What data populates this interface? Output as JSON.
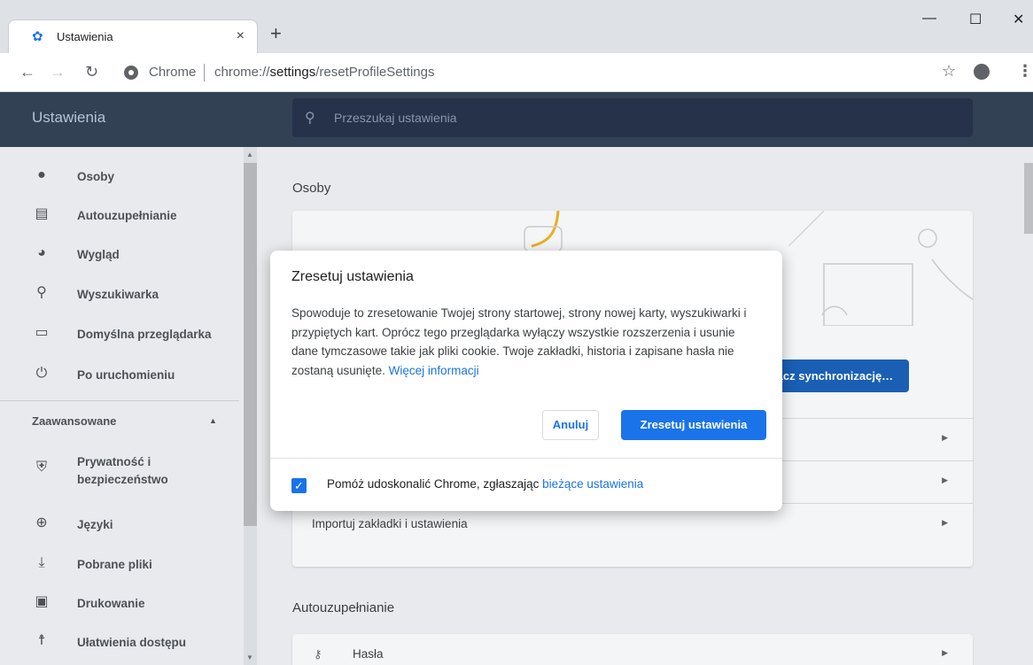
{
  "browser": {
    "tab_title": "Ustawienia",
    "tab_close": "×",
    "new_tab": "+",
    "win_minimize": "—",
    "win_maximize": "☐",
    "win_close": "✕",
    "url_chip": "Chrome",
    "url_prefix": "chrome://",
    "url_bold": "settings",
    "url_rest": "/resetProfileSettings"
  },
  "header": {
    "title": "Ustawienia",
    "search_placeholder": "Przeszukaj ustawienia"
  },
  "sidebar": {
    "items": [
      {
        "label": "Osoby",
        "icon": "person-icon"
      },
      {
        "label": "Autouzupełnianie",
        "icon": "clipboard-icon"
      },
      {
        "label": "Wygląd",
        "icon": "palette-icon"
      },
      {
        "label": "Wyszukiwarka",
        "icon": "search-icon"
      },
      {
        "label": "Domyślna przeglądarka",
        "icon": "browser-icon"
      },
      {
        "label": "Po uruchomieniu",
        "icon": "power-icon"
      }
    ],
    "advanced_label": "Zaawansowane",
    "advanced_items": [
      {
        "label": "Prywatność i bezpieczeństwo",
        "icon": "shield-icon"
      },
      {
        "label": "Języki",
        "icon": "globe-icon"
      },
      {
        "label": "Pobrane pliki",
        "icon": "download-icon"
      },
      {
        "label": "Drukowanie",
        "icon": "printer-icon"
      },
      {
        "label": "Ułatwienia dostępu",
        "icon": "accessibility-icon"
      }
    ]
  },
  "main": {
    "section_people": "Osoby",
    "sync_button": "Włącz synchronizację…",
    "import_row": "Importuj zakładki i ustawienia",
    "section_autofill": "Autouzupełnianie",
    "passwords_row": "Hasła"
  },
  "dialog": {
    "title": "Zresetuj ustawienia",
    "body": "Spowoduje to zresetowanie Twojej strony startowej, strony nowej karty, wyszukiwarki i przypiętych kart. Oprócz tego przeglądarka wyłączy wszystkie rozszerzenia i usunie dane tymczasowe takie jak pliki cookie. Twoje zakładki, historia i zapisane hasła nie zostaną usunięte.",
    "more_info_link": "Więcej informacji",
    "cancel": "Anuluj",
    "reset": "Zresetuj ustawienia",
    "checkbox_label": "Pomóż udoskonalić Chrome, zgłaszając",
    "checkbox_link": "bieżące ustawienia",
    "checkbox_checked": true
  },
  "colors": {
    "accent": "#1a73e8",
    "header_bg": "#334155"
  }
}
